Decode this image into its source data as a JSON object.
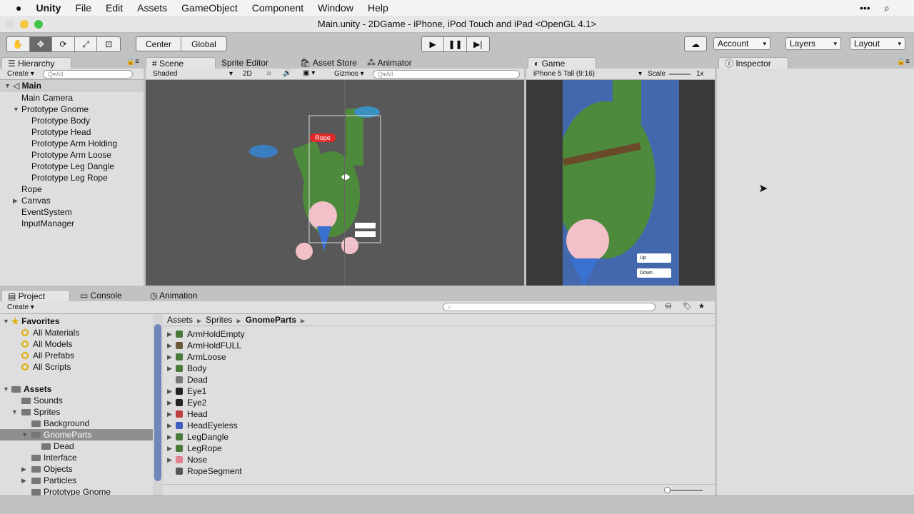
{
  "menubar": {
    "app": "Unity",
    "items": [
      "File",
      "Edit",
      "Assets",
      "GameObject",
      "Component",
      "Window",
      "Help"
    ]
  },
  "window": {
    "title": "Main.unity - 2DGame - iPhone, iPod Touch and iPad <OpenGL 4.1>"
  },
  "toolbar": {
    "pivot": "Center",
    "space": "Global",
    "account": "Account",
    "layers": "Layers",
    "layout": "Layout"
  },
  "hierarchy": {
    "tab": "Hierarchy",
    "create": "Create",
    "search_placeholder": "Q▾All",
    "scene": "Main",
    "items": [
      {
        "label": "Main Camera",
        "indent": 1
      },
      {
        "label": "Prototype Gnome",
        "indent": 1,
        "expanded": true
      },
      {
        "label": "Prototype Body",
        "indent": 2
      },
      {
        "label": "Prototype Head",
        "indent": 2
      },
      {
        "label": "Prototype Arm Holding",
        "indent": 2
      },
      {
        "label": "Prototype Arm Loose",
        "indent": 2
      },
      {
        "label": "Prototype Leg Dangle",
        "indent": 2
      },
      {
        "label": "Prototype Leg Rope",
        "indent": 2
      },
      {
        "label": "Rope",
        "indent": 1
      },
      {
        "label": "Canvas",
        "indent": 1,
        "collapsed": true
      },
      {
        "label": "EventSystem",
        "indent": 1
      },
      {
        "label": "InputManager",
        "indent": 1
      }
    ]
  },
  "scene": {
    "tabs": [
      "Scene",
      "Sprite Editor",
      "Asset Store",
      "Animator"
    ],
    "shading": "Shaded",
    "mode2d": "2D",
    "gizmos": "Gizmos",
    "search_placeholder": "Q▾All",
    "rope_label": "Rope"
  },
  "game": {
    "tab": "Game",
    "aspect": "iPhone 5 Tall (9:16)",
    "scale_label": "Scale",
    "scale_value": "1x",
    "buttons": [
      "Up",
      "Down"
    ]
  },
  "inspector": {
    "tab": "Inspector"
  },
  "project": {
    "tabs": [
      "Project",
      "Console",
      "Animation"
    ],
    "create": "Create",
    "favorites": {
      "label": "Favorites",
      "items": [
        "All Materials",
        "All Models",
        "All Prefabs",
        "All Scripts"
      ]
    },
    "assets": {
      "label": "Assets",
      "tree": [
        {
          "label": "Sounds",
          "indent": 1
        },
        {
          "label": "Sprites",
          "indent": 1,
          "expanded": true
        },
        {
          "label": "Background",
          "indent": 2
        },
        {
          "label": "GnomeParts",
          "indent": 2,
          "expanded": true,
          "selected": true
        },
        {
          "label": "Dead",
          "indent": 3
        },
        {
          "label": "Interface",
          "indent": 2
        },
        {
          "label": "Objects",
          "indent": 2,
          "collapsed": true
        },
        {
          "label": "Particles",
          "indent": 2,
          "collapsed": true
        },
        {
          "label": "Prototype Gnome",
          "indent": 2
        }
      ]
    },
    "breadcrumb": [
      "Assets",
      "Sprites",
      "GnomeParts"
    ],
    "files": [
      {
        "name": "ArmHoldEmpty",
        "arrow": true,
        "color": "#4a7a3a"
      },
      {
        "name": "ArmHoldFULL",
        "arrow": true,
        "color": "#6a5a3a"
      },
      {
        "name": "ArmLoose",
        "arrow": true,
        "color": "#4a7a3a"
      },
      {
        "name": "Body",
        "arrow": true,
        "color": "#4a7a3a"
      },
      {
        "name": "Dead",
        "arrow": false,
        "color": "#777777"
      },
      {
        "name": "Eye1",
        "arrow": true,
        "color": "#222222"
      },
      {
        "name": "Eye2",
        "arrow": true,
        "color": "#222222"
      },
      {
        "name": "Head",
        "arrow": true,
        "color": "#c04040"
      },
      {
        "name": "HeadEyeless",
        "arrow": true,
        "color": "#4060c0"
      },
      {
        "name": "LegDangle",
        "arrow": true,
        "color": "#4a7a3a"
      },
      {
        "name": "LegRope",
        "arrow": true,
        "color": "#4a7a3a"
      },
      {
        "name": "Nose",
        "arrow": true,
        "color": "#e08090"
      },
      {
        "name": "RopeSegment",
        "arrow": false,
        "color": "#555555"
      }
    ]
  }
}
